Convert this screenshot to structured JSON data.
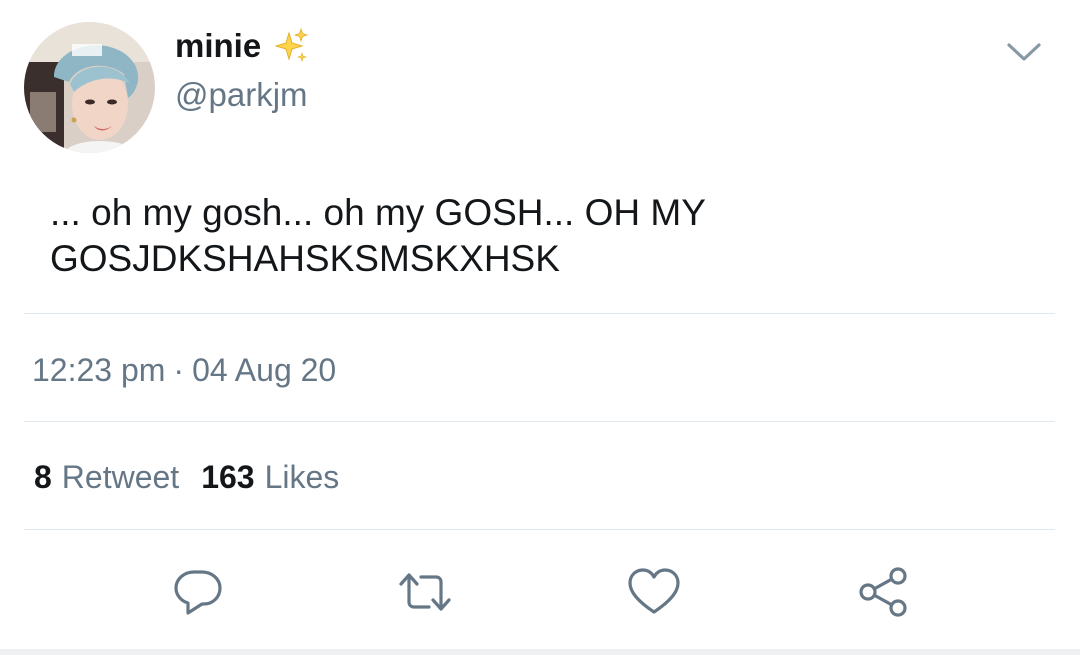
{
  "user": {
    "display_name": "minie",
    "handle": "@parkjm",
    "avatar_icon": "profile-photo",
    "name_emoji_icon": "sparkles-icon"
  },
  "tweet": {
    "text": "... oh my gosh... oh my GOSH... OH MY\nGOSJDKSHAHSKSMSKXHSK",
    "time": "12:23 pm",
    "separator": "·",
    "date": "04 Aug 20"
  },
  "stats": {
    "retweets_count": "8",
    "retweets_label": "Retweet",
    "likes_count": "163",
    "likes_label": "Likes"
  },
  "actions": {
    "reply_icon": "reply-icon",
    "retweet_icon": "retweet-icon",
    "like_icon": "heart-icon",
    "share_icon": "share-icon"
  },
  "colors": {
    "text_primary": "#14171a",
    "text_secondary": "#657786",
    "divider": "#e1e8ed",
    "icon": "#657786",
    "sparkle": "#f2c94c"
  }
}
